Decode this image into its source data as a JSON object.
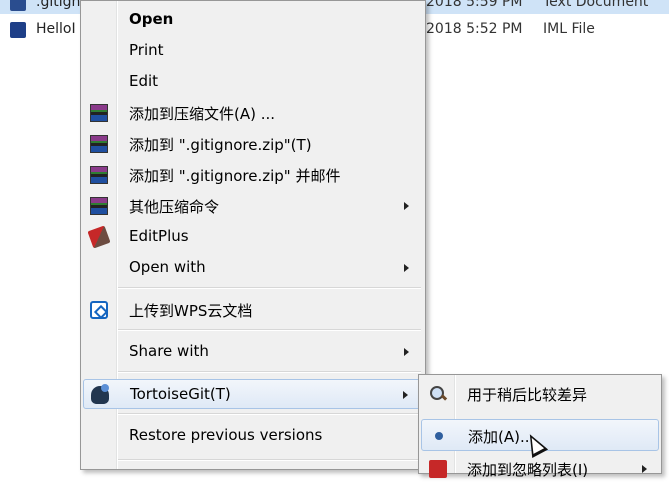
{
  "file_list": [
    {
      "name": ".gitignore",
      "date": "2018 5:59 PM",
      "type": "Text Document",
      "selected": true
    },
    {
      "name": "HelloI",
      "date": "2018 5:52 PM",
      "type": "IML File",
      "selected": false
    }
  ],
  "context_menu": {
    "items": [
      {
        "label": "Open",
        "bold": true,
        "icon": "none"
      },
      {
        "label": "Print",
        "icon": "none"
      },
      {
        "label": "Edit",
        "icon": "none"
      },
      {
        "label": "添加到压缩文件(A) ...",
        "icon": "winrar-icon"
      },
      {
        "label": "添加到 \".gitignore.zip\"(T)",
        "icon": "winrar-icon"
      },
      {
        "label": "添加到 \".gitignore.zip\" 并邮件",
        "icon": "winrar-icon"
      },
      {
        "label": "其他压缩命令",
        "icon": "winrar-icon",
        "submenu": true
      },
      {
        "label": "EditPlus",
        "icon": "editplus-icon"
      },
      {
        "label": "Open with",
        "icon": "none",
        "submenu": true
      },
      {
        "label": "上传到WPS云文档",
        "icon": "wps-cloud-icon"
      },
      {
        "label": "Share with",
        "icon": "none",
        "submenu": true
      },
      {
        "label": "TortoiseGit(T)",
        "icon": "tortoisegit-icon",
        "submenu": true,
        "highlighted": true
      },
      {
        "label": "Restore previous versions",
        "icon": "none"
      }
    ]
  },
  "tortoisegit_submenu": {
    "items": [
      {
        "label": "用于稍后比较差异",
        "icon": "magnifier-icon"
      },
      {
        "label": "添加(A)...",
        "icon": "add-icon",
        "highlighted": true
      },
      {
        "label": "添加到忽略列表(I)",
        "icon": "ignore-icon",
        "submenu": true
      }
    ]
  }
}
